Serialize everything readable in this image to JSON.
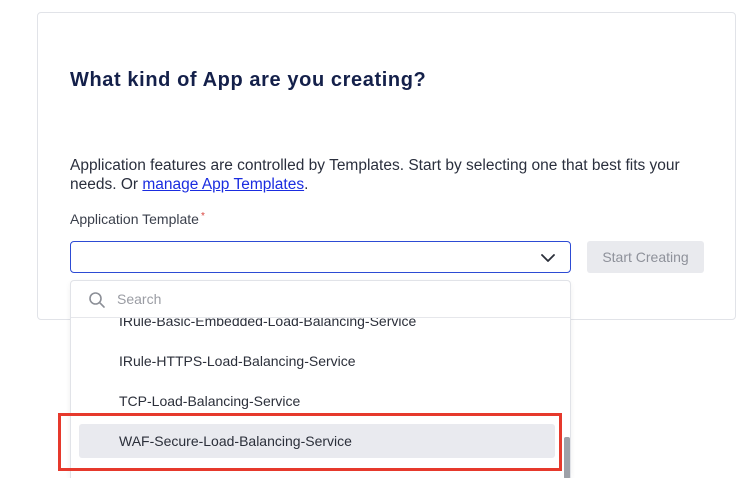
{
  "page": {
    "title": "What kind of App are you creating?",
    "description_text": "Application features are controlled by Templates. Start by selecting one that best fits your needs. Or ",
    "description_link": "manage App Templates",
    "description_end": "."
  },
  "form": {
    "template_label": "Application Template",
    "required_marker": "*",
    "selected_value": "",
    "start_button": "Start Creating"
  },
  "dropdown": {
    "search_placeholder": "Search",
    "items": [
      {
        "label": "IRule-Basic-Embedded-Load-Balancing-Service",
        "selected": false
      },
      {
        "label": "IRule-HTTPS-Load-Balancing-Service",
        "selected": false
      },
      {
        "label": "TCP-Load-Balancing-Service",
        "selected": false
      },
      {
        "label": "WAF-Secure-Load-Balancing-Service",
        "selected": true
      }
    ]
  },
  "colors": {
    "accent": "#2d4bd4",
    "title": "#14204a",
    "link": "#1a2ce0",
    "highlight_box": "#e6392c",
    "required": "#d9453f"
  },
  "icons": {
    "select_chevron": "chevron-down-icon",
    "search": "search-icon"
  }
}
